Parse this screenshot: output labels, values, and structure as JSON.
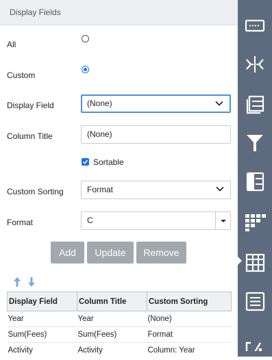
{
  "panel": {
    "title": "Display Fields",
    "all_label": "All",
    "custom_label": "Custom",
    "mode_selected": "Custom",
    "display_field_label": "Display Field",
    "display_field_value": "(None)",
    "column_title_label": "Column Title",
    "column_title_value": "(None)",
    "sortable_label": "Sortable",
    "sortable_checked": true,
    "custom_sorting_label": "Custom Sorting",
    "custom_sorting_value": "Format",
    "format_label": "Format",
    "format_value": "C"
  },
  "buttons": {
    "add": "Add",
    "update": "Update",
    "remove": "Remove"
  },
  "table": {
    "headers": [
      "Display Field",
      "Column Title",
      "Custom Sorting"
    ],
    "rows": [
      [
        "Year",
        "Year",
        "(None)"
      ],
      [
        "Sum(Fees)",
        "Sum(Fees)",
        "Format"
      ],
      [
        "Activity",
        "Activity",
        "Column: Year"
      ]
    ]
  },
  "sidebar": {
    "icons": [
      "keyboard-icon",
      "merge-arrows-icon",
      "layers-icon",
      "filter-icon",
      "list-panel-icon",
      "dot-grid-icon",
      "table-grid-icon",
      "lines-icon",
      "percent-icon"
    ],
    "active_icon": "table-grid-icon"
  },
  "colors": {
    "accent": "#1a73e8",
    "sidebar": "#5e6b7e",
    "button": "#a3a8ae"
  }
}
